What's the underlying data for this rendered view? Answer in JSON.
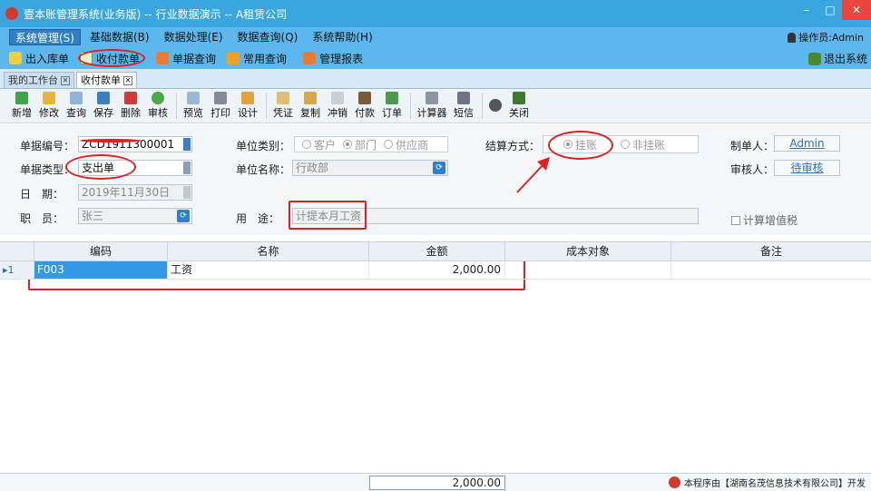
{
  "window": {
    "title": "壹本账管理系统(业务版) -- 行业数据演示 -- A租赁公司",
    "minimize": "–",
    "maximize": "□",
    "close": "✕"
  },
  "menu": {
    "items": [
      "系统管理(S)",
      "基础数据(B)",
      "数据处理(E)",
      "数据查询(Q)",
      "系统帮助(H)"
    ],
    "operator": "操作员:Admin"
  },
  "quickbar": {
    "items": [
      "出入库单",
      "收付款单",
      "单据查询",
      "常用查询",
      "管理报表"
    ],
    "exit": "退出系统"
  },
  "tabs": [
    "我的工作台",
    "收付款单"
  ],
  "toolbar": [
    "新增",
    "修改",
    "查询",
    "保存",
    "删除",
    "审核",
    "预览",
    "打印",
    "设计",
    "凭证",
    "复制",
    "冲销",
    "付款",
    "订单",
    "计算器",
    "短信",
    "关闭"
  ],
  "form": {
    "doc_no_label": "单据编号：",
    "doc_no": "ZCD1911300001",
    "doc_type_label": "单据类型：",
    "doc_type": "支出单",
    "date_label": "日　期：",
    "date": "2019年11月30日",
    "staff_label": "职　员：",
    "staff": "张三",
    "unit_type_label": "单位类别：",
    "unit_type_options": [
      "客户",
      "部门",
      "供应商"
    ],
    "unit_type_selected": "部门",
    "unit_name_label": "单位名称：",
    "unit_name": "行政部",
    "purpose_label": "用　途：",
    "purpose": "计提本月工资",
    "settle_label": "结算方式：",
    "settle_options": [
      "挂账",
      "非挂账"
    ],
    "settle_selected": "挂账",
    "maker_label": "制单人：",
    "maker": "Admin",
    "auditor_label": "审核人：",
    "auditor": "待审核",
    "vat_label": "计算增值税"
  },
  "grid": {
    "columns": [
      "编码",
      "名称",
      "金额",
      "成本对象",
      "备注"
    ],
    "rows": [
      {
        "index": "1",
        "code": "F003",
        "name": "工资",
        "amount": "2,000.00",
        "cost": "",
        "note": ""
      }
    ],
    "total": "2,000.00"
  },
  "footer": {
    "credit": "本程序由【湖南名茂信息技术有限公司】开发"
  },
  "colors": {
    "title_bar": "#3aa6e0",
    "menu_bar": "#5cb8ec",
    "selected_cell": "#3399e6",
    "annotation": "#e02020"
  }
}
